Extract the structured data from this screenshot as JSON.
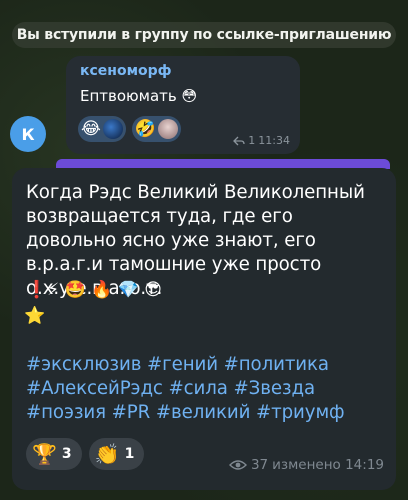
{
  "service_message": "Вы вступили в группу по ссылке-приглашению",
  "small_message": {
    "avatar_letter": "К",
    "avatar_color": "#4a9ee8",
    "sender": "ксеноморф",
    "text": "Ептвоюмать 😳",
    "reactions": [
      {
        "emoji": "😂",
        "avatar": "user-avatar-blue"
      },
      {
        "emoji": "🤣",
        "avatar": "user-avatar-pink"
      }
    ],
    "reply_count": "1",
    "time": "11:34"
  },
  "main_message": {
    "text": "Когда Рэдс Великий Великолепный\nвозвращается туда, где его\nдовольно ясно уже знают, его\nв.р.а.г.и тамошние уже просто\nо.х.у.е.в.а.ю.т.",
    "emoji_line": "❗⚡ 🤩 🔥 💎 😎",
    "emoji_line2": "⭐",
    "hashtags": "#эксклюзив #гений #политика #АлексейРэдс #сила #Звезда #поэзия #PR #великий #триумф",
    "reactions": [
      {
        "emoji": "🏆",
        "count": "3"
      },
      {
        "emoji": "👏",
        "count": "1"
      }
    ],
    "views": "37",
    "status": "изменено 14:19"
  },
  "accent_color": "#6c4bd8",
  "link_color": "#6fb1f1"
}
